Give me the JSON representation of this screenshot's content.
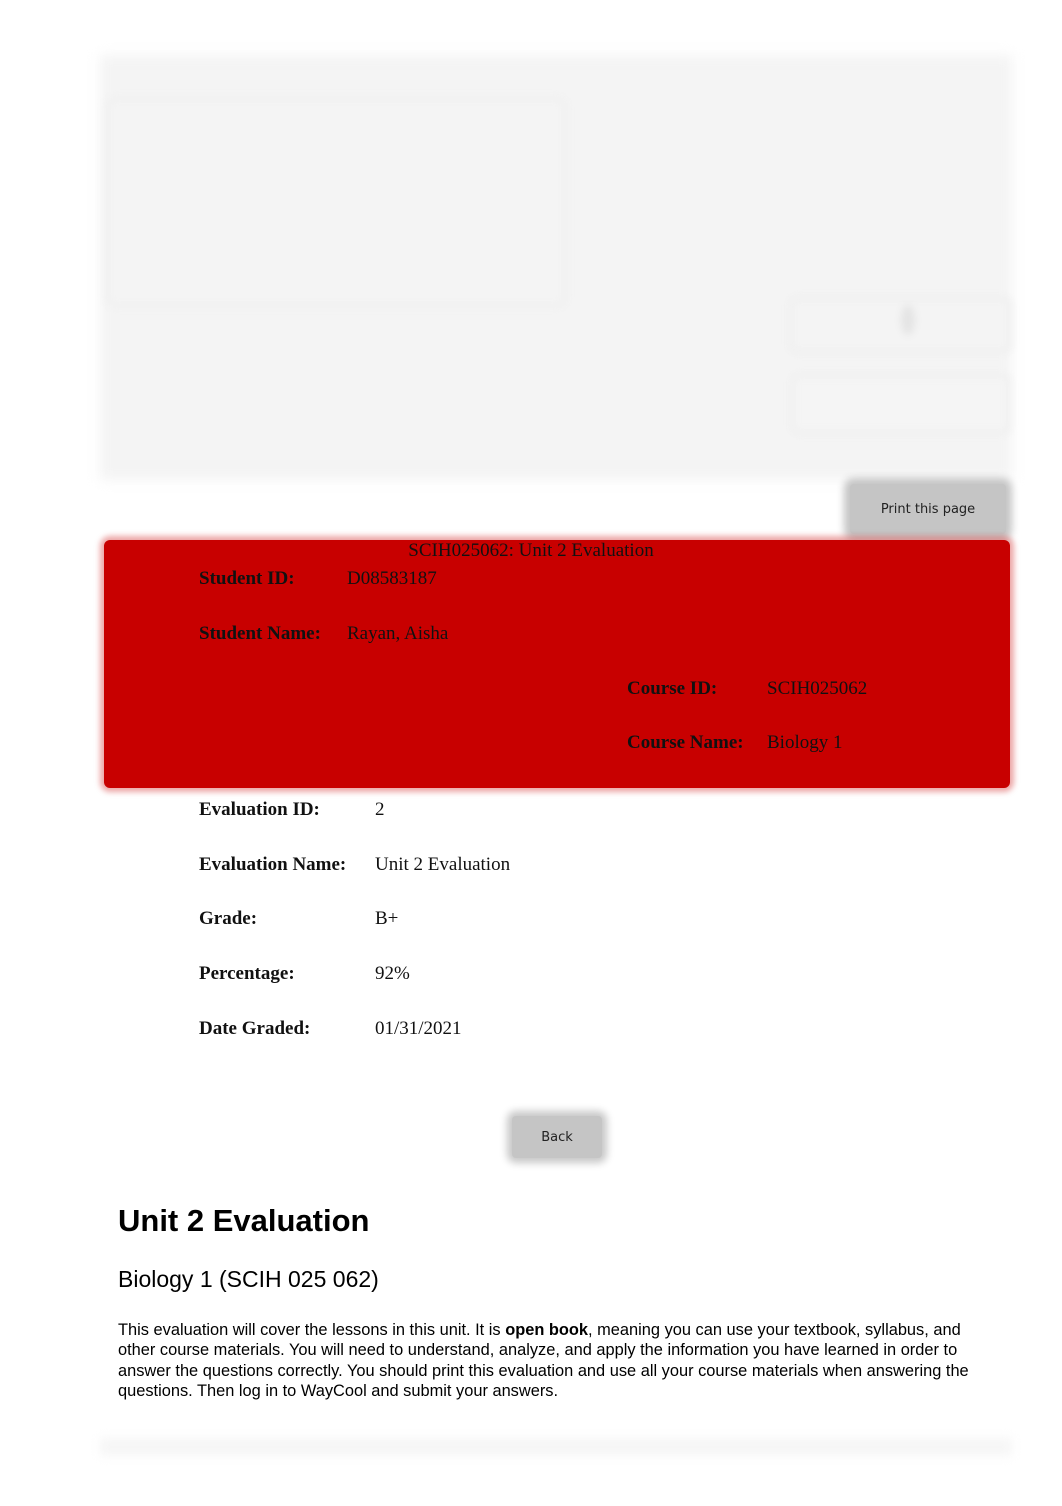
{
  "header": {
    "print_button_label": "Print this page"
  },
  "banner": {
    "title": "SCIH025062: Unit 2 Evaluation",
    "background_color": "#c80000",
    "student": {
      "id_label": "Student ID:",
      "id_value": "D08583187",
      "name_label": "Student Name:",
      "name_value": "Rayan, Aisha"
    },
    "course": {
      "id_label": "Course ID:",
      "id_value": "SCIH025062",
      "name_label": "Course Name:",
      "name_value": "Biology 1"
    }
  },
  "evaluation": {
    "fields": [
      {
        "label": "Evaluation ID:",
        "value": "2"
      },
      {
        "label": "Evaluation Name:",
        "value": "Unit 2 Evaluation"
      },
      {
        "label": "Grade:",
        "value": "B+"
      },
      {
        "label": "Percentage:",
        "value": "92%"
      },
      {
        "label": "Date Graded:",
        "value": "01/31/2021"
      }
    ]
  },
  "back_button_label": "Back",
  "document": {
    "heading": "Unit 2 Evaluation",
    "subheading": "Biology 1 (SCIH 025 062)",
    "intro_before_bold": "This evaluation will cover the lessons in this unit. It is ",
    "intro_bold": "open book",
    "intro_after_bold": ", meaning you can use your textbook, syllabus, and other course materials. You will need to understand, analyze, and apply the information you have learned in order to answer the questions correctly. You should print this evaluation and use all your course materials when answering the questions. Then log in to WayCool and submit your answers."
  }
}
